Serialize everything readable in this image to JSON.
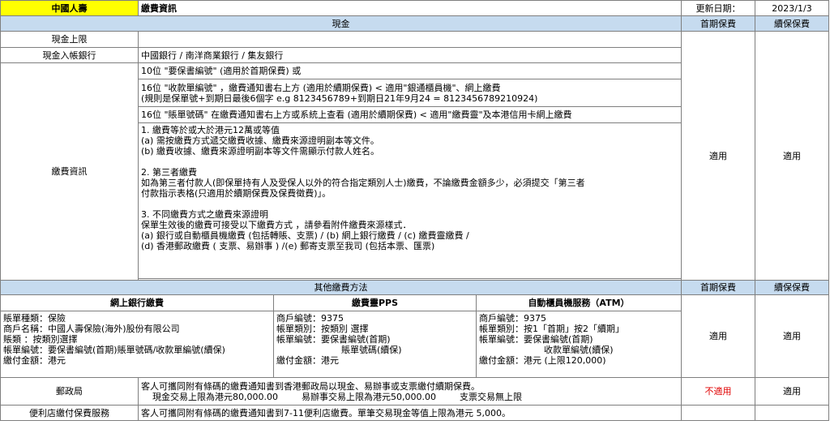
{
  "header": {
    "company": "中國人壽",
    "title": "繳費資訊",
    "updated_label": "更新日期：",
    "updated_date": "2023/1/3"
  },
  "cash": {
    "section_title": "現金",
    "col_first": "首期保費",
    "col_renew": "續保保費",
    "limit_label": "現金上限",
    "limit_value": "",
    "banks_label": "現金入帳銀行",
    "banks_value": "中國銀行 / 南洋商業銀行 / 集友銀行",
    "info_label": "繳費資訊",
    "line1": "10位 \"要保書編號\" (適用於首期保費) 或",
    "line2a": "16位 \"收款單編號\" ，繳費通知書右上方 (適用於續期保費) < 適用\"銀通櫃員機\"、網上繳費",
    "line2b": "(規則是保單號+到期日最後6個字 e.g 8123456789+到期日21年9月24 = 8123456789210924)",
    "line3": "16位 \"賬單號碼\" 在繳費通知書右上方或系統上查看 (適用於續期保費) < 適用\"繳費靈\"及本港信用卡網上繳費",
    "notes": [
      "1.    繳費等於或大於港元12萬或等值",
      "(a) 需按繳費方式遞交繳費收據、繳費來源證明副本等文件。",
      "(b) 繳費收據、繳費來源證明副本等文件需顯示付款人姓名。",
      "",
      "2.    第三者繳費",
      "如為第三者付款人(即保單持有人及受保人以外的符合指定類別人士)繳費，不論繳費金額多少，必須提交「第三者",
      "付款指示表格(只適用於續期保費及保費徵費)」。",
      "",
      "3.    不同繳費方式之繳費來源證明",
      "保單生效後的繳費可接受以下繳費方式 ，請參看附件繳費來源樣式．",
      "(a)    銀行或自動櫃員機繳費 (包括轉賬、支票) / (b)    網上銀行繳費 / (c)    繳費靈繳費 /",
      "(d)    香港郵政繳費 ( 支票、易辦事 ) /(e)    郵寄支票至我司 (包括本票、匯票)"
    ],
    "first_status": "適用",
    "renew_status": "適用"
  },
  "other": {
    "section_title": "其他繳費方法",
    "col_first": "首期保費",
    "col_renew": "續保保費",
    "online_title": "網上銀行繳費",
    "pps_title": "繳費靈PPS",
    "atm_title": "自動櫃員機服務（ATM）",
    "online_lines": [
      "賬單種類：保險",
      "商戶名稱：中國人壽保險(海外)股份有限公司",
      "賬類    ：按類別選擇",
      "帳單編號：要保書編號(首期)賬單號碼/收款單編號(續保)",
      "繳付金額：港元"
    ],
    "pps_lines": [
      "商戶編號：9375",
      "帳單類別：按類別 選擇",
      "帳單編號：要保書編號(首期)",
      "賬單號碼(續保)",
      "繳付金額：港元"
    ],
    "atm_lines": [
      "商戶編號：9375",
      "帳單類別：按1「首期」按2「續期」",
      "帳單編號：要保書編號(首期)",
      "收款單編號(續保)",
      "繳付金額：港元 (上限120,000)"
    ],
    "banking_first": "適用",
    "banking_renew": "適用",
    "post_label": "郵政局",
    "post_line1": "客人可攜同附有條碼的繳費通知書到香港郵政局以現金、易辦事或支票繳付續期保費。",
    "post_line2a": "現金交易上限為港元80,000.00",
    "post_line2b": "易辦事交易上限為港元50,000.00",
    "post_line2c": "支票交易無上限",
    "post_first": "不適用",
    "post_renew": "適用",
    "store_label": "便利店繳付保費服務",
    "store_line": "客人可攜同附有條碼的繳費通知書到7-11便利店繳費。單筆交易現金等值上限為港元 5,000。"
  },
  "colors": {
    "header_fill": "#c6dbef",
    "company_fill": "#ffff00",
    "na_red": "#e00000",
    "grid": "#7f7f7f"
  }
}
